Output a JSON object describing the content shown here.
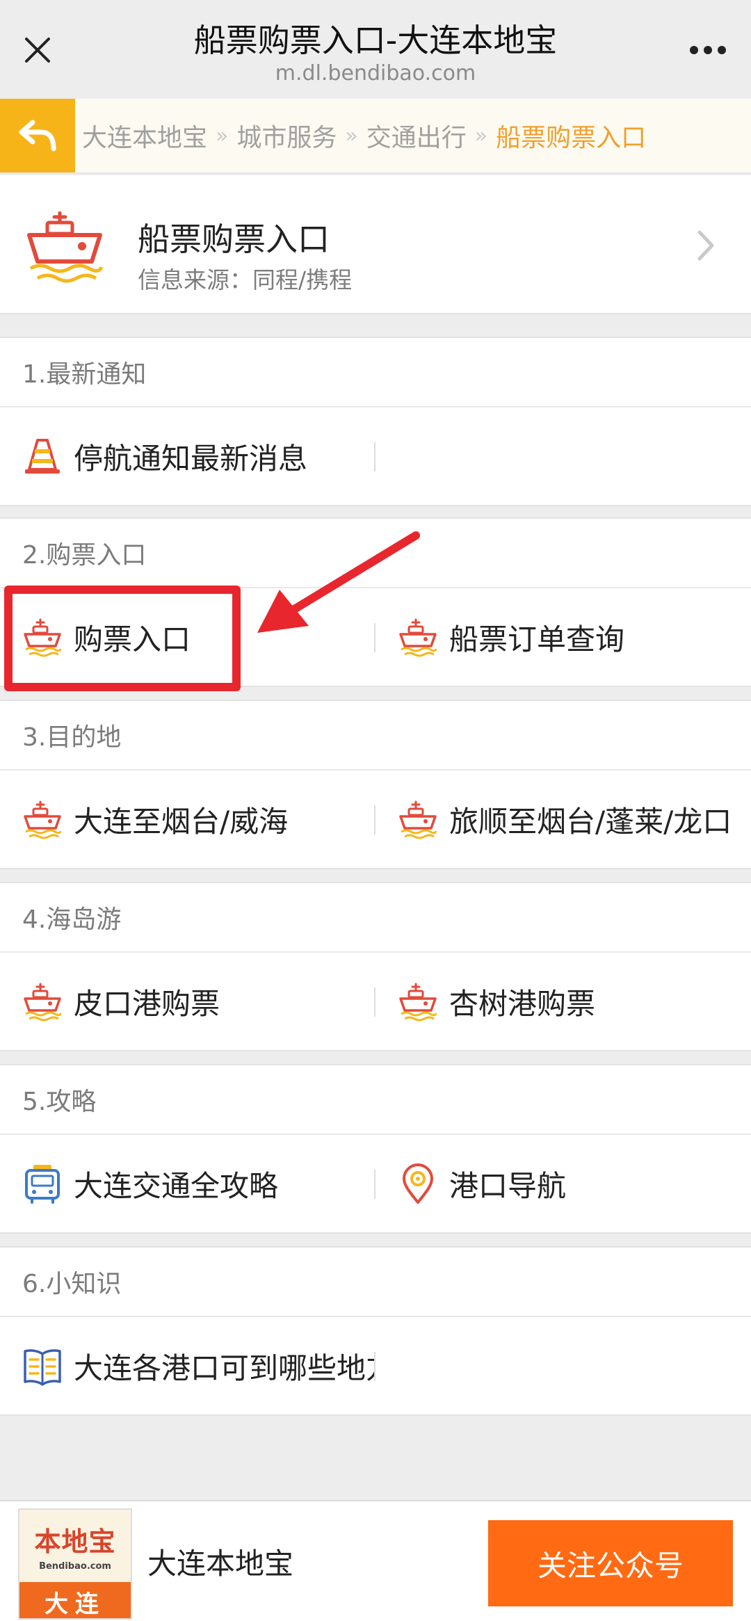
{
  "titlebar": {
    "title": "船票购票入口-大连本地宝",
    "url": "m.dl.bendibao.com"
  },
  "breadcrumb": [
    "大连本地宝",
    "城市服务",
    "交通出行",
    "船票购票入口"
  ],
  "breadcrumb_sep": "»",
  "header": {
    "title": "船票购票入口",
    "subtitle": "信息来源：同程/携程"
  },
  "sections": [
    {
      "heading": "1.最新通知",
      "items": [
        {
          "label": "停航通知最新消息",
          "icon": "traffic-cone-icon"
        }
      ]
    },
    {
      "heading": "2.购票入口",
      "items": [
        {
          "label": "购票入口",
          "icon": "ship-icon"
        },
        {
          "label": "船票订单查询",
          "icon": "ship-icon"
        }
      ]
    },
    {
      "heading": "3.目的地",
      "items": [
        {
          "label": "大连至烟台/威海",
          "icon": "ship-icon"
        },
        {
          "label": "旅顺至烟台/蓬莱/龙口",
          "icon": "ship-icon"
        }
      ]
    },
    {
      "heading": "4.海岛游",
      "items": [
        {
          "label": "皮口港购票",
          "icon": "ship-icon"
        },
        {
          "label": "杏树港购票",
          "icon": "ship-icon"
        }
      ]
    },
    {
      "heading": "5.攻略",
      "items": [
        {
          "label": "大连交通全攻略",
          "icon": "bus-icon"
        },
        {
          "label": "港口导航",
          "icon": "map-pin-icon"
        }
      ]
    },
    {
      "heading": "6.小知识",
      "items": [
        {
          "label": "大连各港口可到哪些地方",
          "icon": "book-icon"
        }
      ]
    }
  ],
  "footer": {
    "logo_name": "本地宝",
    "logo_domain": "Bendibao.com",
    "logo_city": "大连",
    "account_name": "大连本地宝",
    "follow_label": "关注公众号"
  },
  "colors": {
    "accent_orange": "#ff6a12",
    "breadcrumb_active": "#f0a02c",
    "back_button": "#f6b418",
    "annotation_red": "#e8262d",
    "ship_red": "#e24a3b",
    "wave_yellow": "#f5b71a"
  }
}
